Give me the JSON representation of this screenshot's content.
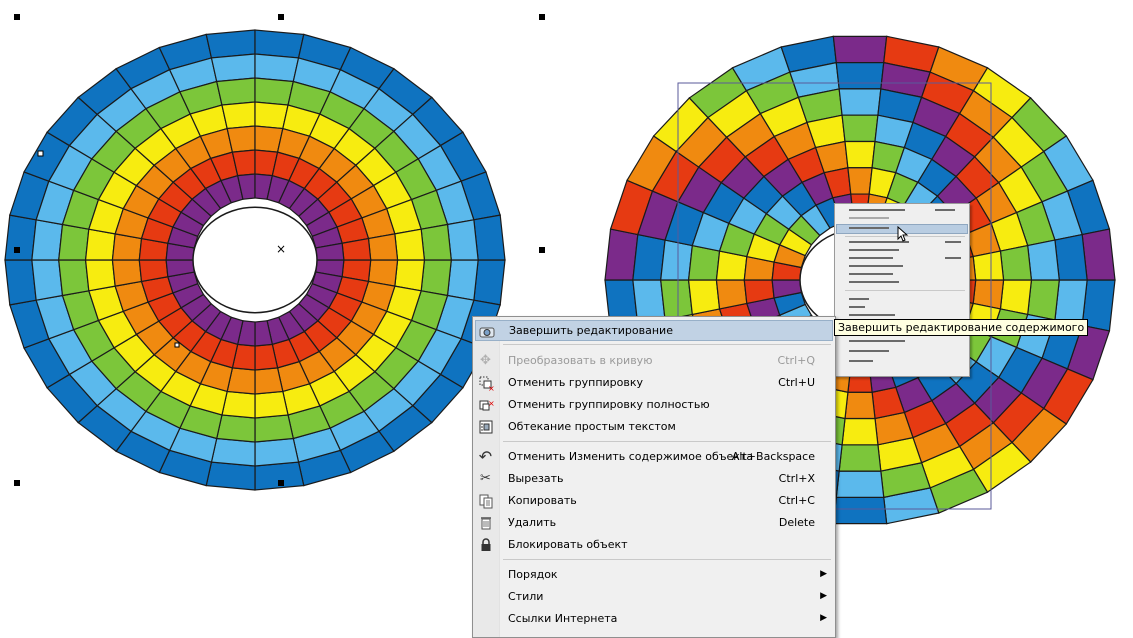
{
  "context_menu": {
    "items": [
      {
        "label": "Завершить редактирование",
        "shortcut": "",
        "icon": "finish-edit-icon",
        "highlighted": true,
        "disabled": false,
        "submenu": false
      },
      {
        "label": "Преобразовать в кривую",
        "shortcut": "Ctrl+Q",
        "icon": "convert-curve-icon",
        "highlighted": false,
        "disabled": true,
        "submenu": false
      },
      {
        "label": "Отменить группировку",
        "shortcut": "Ctrl+U",
        "icon": "ungroup-icon",
        "highlighted": false,
        "disabled": false,
        "submenu": false
      },
      {
        "label": "Отменить группировку полностью",
        "shortcut": "",
        "icon": "ungroup-all-icon",
        "highlighted": false,
        "disabled": false,
        "submenu": false
      },
      {
        "label": "Обтекание простым текстом",
        "shortcut": "",
        "icon": "text-wrap-icon",
        "highlighted": false,
        "disabled": false,
        "submenu": false
      },
      {
        "label": "Отменить Изменить содержимое объекта",
        "shortcut": "Alt+Backspace",
        "icon": "undo-icon",
        "highlighted": false,
        "disabled": false,
        "submenu": false
      },
      {
        "label": "Вырезать",
        "shortcut": "Ctrl+X",
        "icon": "scissors-icon",
        "highlighted": false,
        "disabled": false,
        "submenu": false
      },
      {
        "label": "Копировать",
        "shortcut": "Ctrl+C",
        "icon": "copy-icon",
        "highlighted": false,
        "disabled": false,
        "submenu": false
      },
      {
        "label": "Удалить",
        "shortcut": "Delete",
        "icon": "trash-icon",
        "highlighted": false,
        "disabled": false,
        "submenu": false
      },
      {
        "label": "Блокировать объект",
        "shortcut": "",
        "icon": "lock-icon",
        "highlighted": false,
        "disabled": false,
        "submenu": false
      },
      {
        "label": "Порядок",
        "shortcut": "",
        "icon": "",
        "highlighted": false,
        "disabled": false,
        "submenu": true
      },
      {
        "label": "Стили",
        "shortcut": "",
        "icon": "",
        "highlighted": false,
        "disabled": false,
        "submenu": true
      },
      {
        "label": "Ссылки Интернета",
        "shortcut": "",
        "icon": "",
        "highlighted": false,
        "disabled": false,
        "submenu": true
      }
    ]
  },
  "tooltip": {
    "text": "Завершить редактирование содержимого"
  },
  "colors": {
    "rings": [
      "#7b2a8a",
      "#e63a12",
      "#f08a10",
      "#f7ec10",
      "#7cc63a",
      "#5bb9ec",
      "#0f73c0"
    ],
    "menu_highlight": "#c1d2e4",
    "menu_bg": "#f0f0f0",
    "tooltip_bg": "#ffffe1"
  }
}
